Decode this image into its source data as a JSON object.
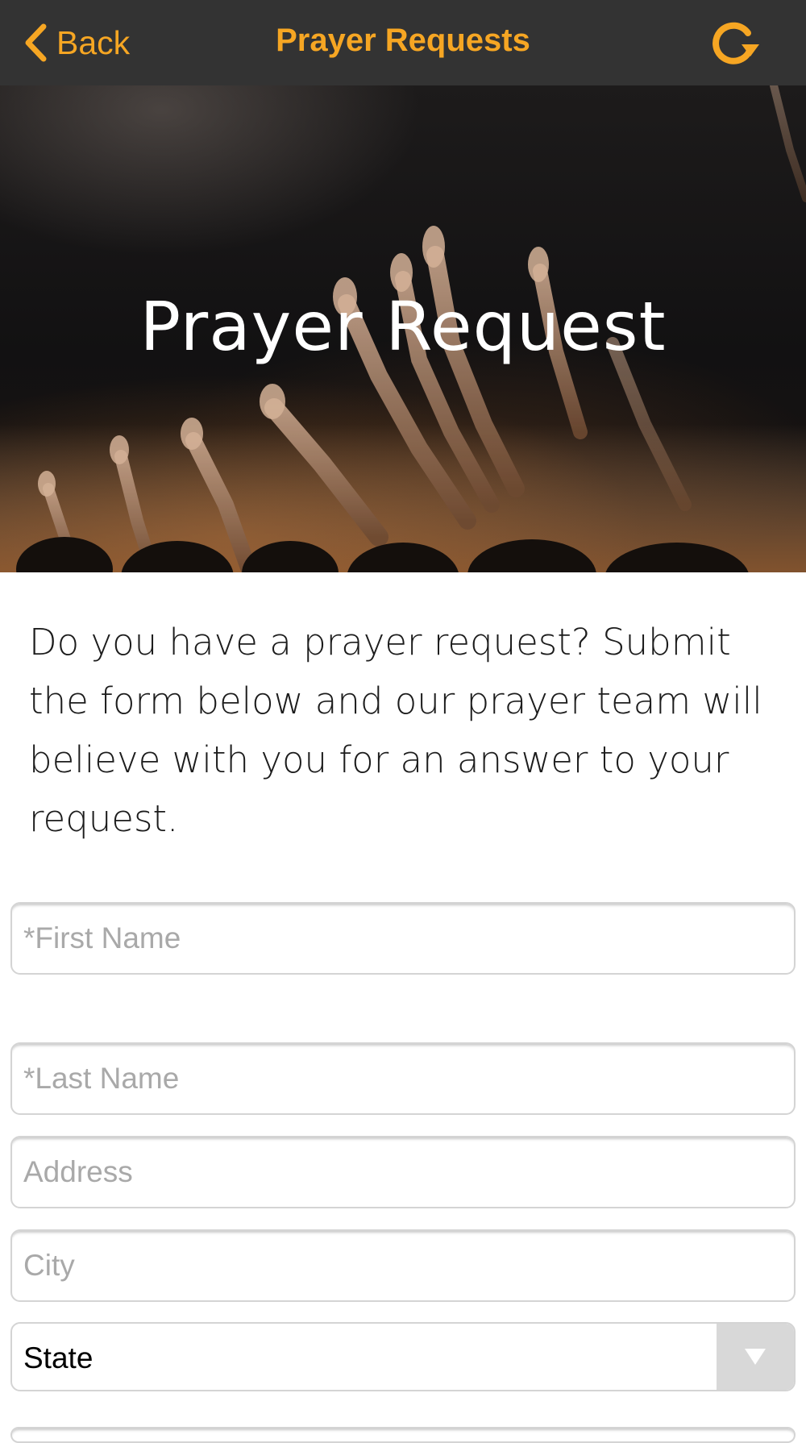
{
  "navbar": {
    "back_label": "Back",
    "title": "Prayer Requests",
    "accent_color": "#f6a623",
    "background_color": "#333333",
    "back_icon": "chevron-left-icon",
    "refresh_icon": "refresh-icon"
  },
  "hero": {
    "title": "Prayer Request",
    "image": "crowd-raising-hands-photo"
  },
  "intro": {
    "text": "Do you have a prayer request? Submit the form below and our prayer team will believe with you for an answer to your request."
  },
  "form": {
    "first_name": {
      "placeholder": "*First Name",
      "value": ""
    },
    "last_name": {
      "placeholder": "*Last Name",
      "value": ""
    },
    "address": {
      "placeholder": "Address",
      "value": ""
    },
    "city": {
      "placeholder": "City",
      "value": ""
    },
    "state": {
      "selected": "State",
      "icon": "triangle-down-icon"
    }
  }
}
